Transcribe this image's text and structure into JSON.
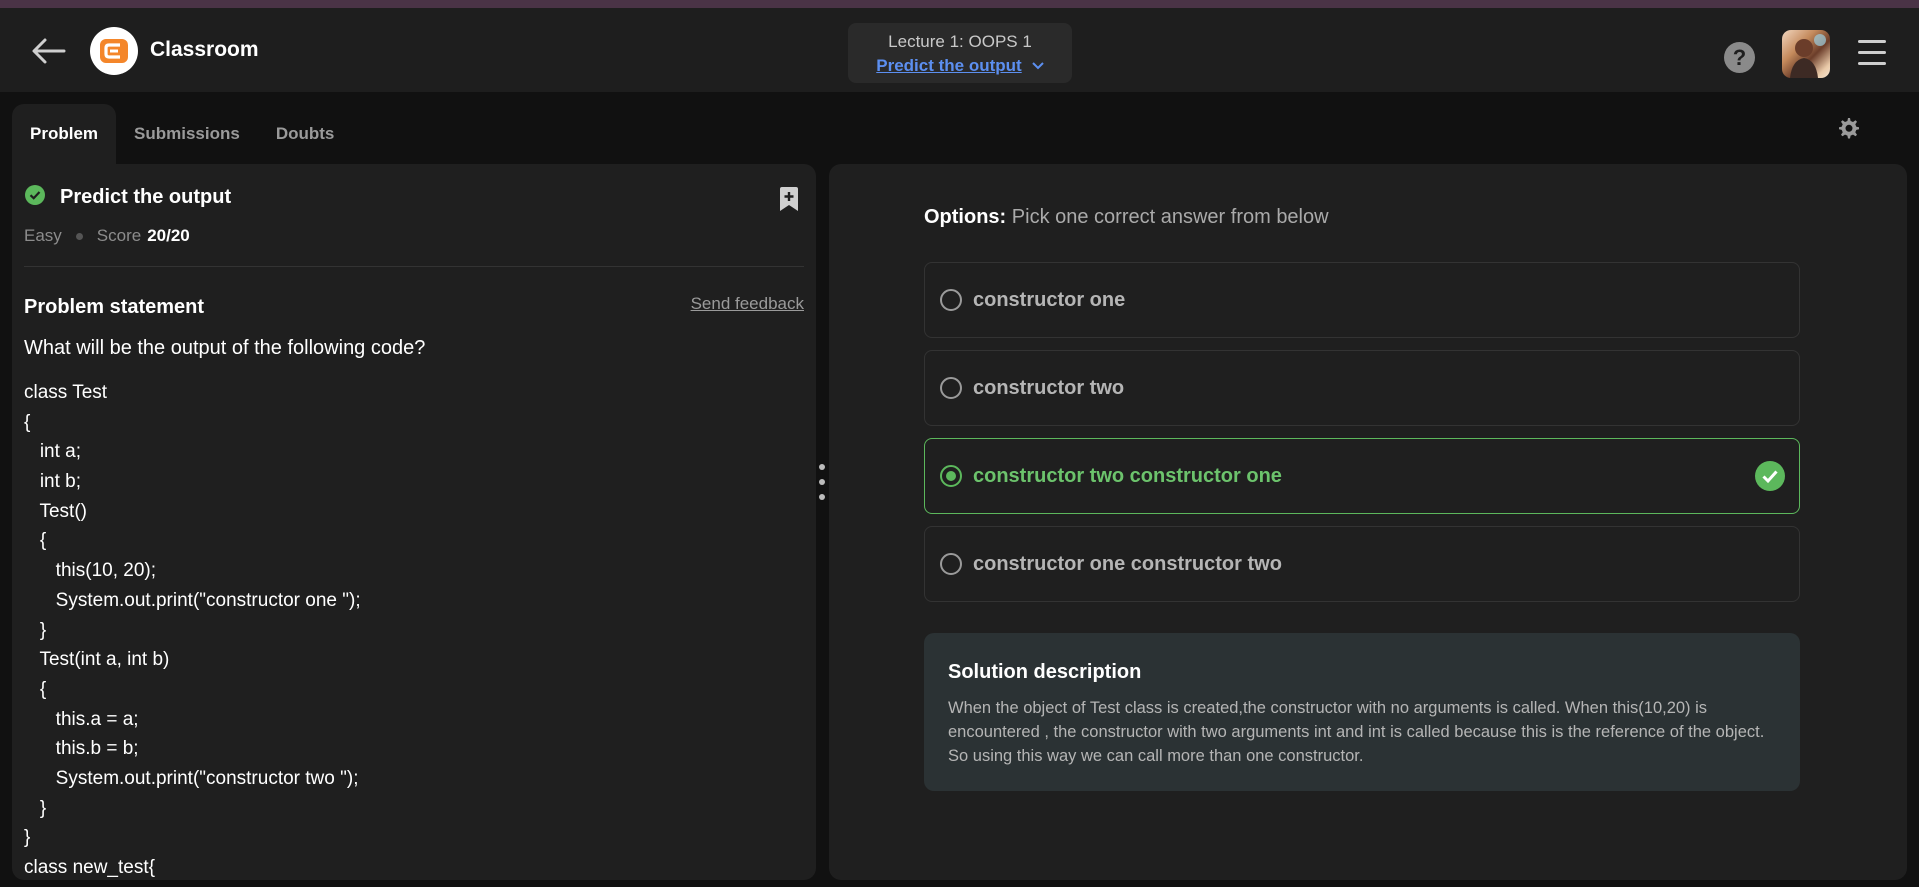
{
  "app": {
    "title": "Classroom"
  },
  "lecture": {
    "title": "Lecture 1: OOPS 1",
    "problem_link": "Predict the output"
  },
  "tabs": [
    {
      "label": "Problem",
      "active": true
    },
    {
      "label": "Submissions",
      "active": false
    },
    {
      "label": "Doubts",
      "active": false
    }
  ],
  "problem": {
    "title": "Predict the output",
    "difficulty": "Easy",
    "score_label": "Score",
    "score_value": "20/20",
    "statement_heading": "Problem statement",
    "feedback_label": "Send feedback",
    "question": "What will be the output of the following code?",
    "code_lines": [
      "class Test",
      "{",
      "   int a;",
      "   int b;",
      "   Test()",
      "   {",
      "      this(10, 20);",
      "      System.out.print(\"constructor one \");",
      "   }",
      "   Test(int a, int b)",
      "   {",
      "      this.a = a;",
      "      this.b = b;",
      "      System.out.print(\"constructor two \");",
      "   }",
      "}",
      "class new_test{"
    ]
  },
  "options": {
    "label": "Options:",
    "instruction": "Pick one correct answer from below",
    "items": [
      {
        "text": "constructor one",
        "correct": false
      },
      {
        "text": "constructor two",
        "correct": false
      },
      {
        "text": "constructor two constructor one",
        "correct": true
      },
      {
        "text": "constructor one constructor two",
        "correct": false
      }
    ]
  },
  "solution": {
    "title": "Solution description",
    "text": "When the object of Test class is created,the constructor with no arguments is called. When this(10,20) is encountered , the constructor with two arguments int and int is called because this is the reference of the object. So using this way we can call more than one constructor."
  },
  "icons": {
    "back": "arrow-left-icon",
    "logo": "codingninjas-logo",
    "help": "question-circle-icon",
    "menu": "hamburger-icon",
    "settings": "gear-icon",
    "bookmark": "bookmark-plus-icon",
    "solved": "check-circle-icon"
  },
  "colors": {
    "accent_link": "#5c8ff0",
    "correct_green": "#5cb85c",
    "logo_orange": "#f4862a"
  }
}
